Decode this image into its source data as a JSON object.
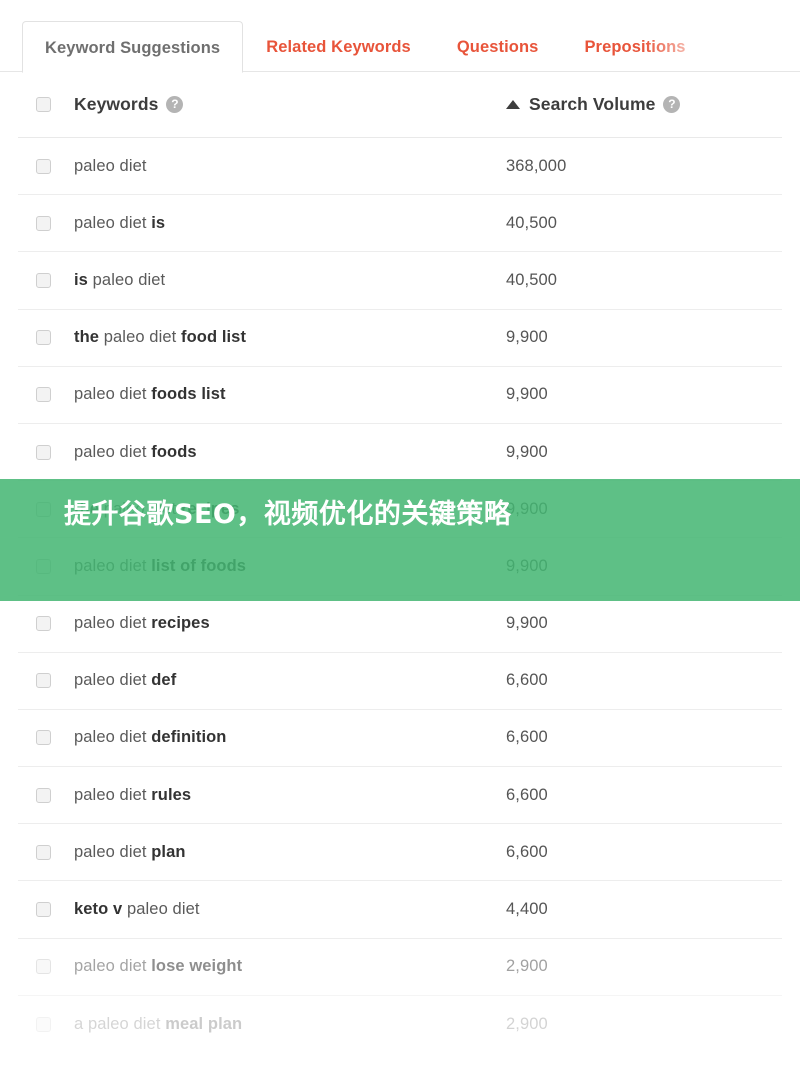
{
  "tabs": [
    {
      "label": "Keyword Suggestions",
      "active": true
    },
    {
      "label": "Related Keywords",
      "active": false
    },
    {
      "label": "Questions",
      "active": false
    },
    {
      "label": "Prepositions",
      "active": false
    }
  ],
  "table": {
    "headers": {
      "keywords": "Keywords",
      "search_volume": "Search Volume",
      "help_glyph": "?",
      "sort_direction": "ascending"
    },
    "rows": [
      {
        "plain": "paleo diet",
        "bold": "",
        "tail": "",
        "volume": "368,000"
      },
      {
        "plain": "paleo diet ",
        "bold": "is",
        "tail": "",
        "volume": "40,500"
      },
      {
        "plain": "",
        "bold": "is",
        "tail": " paleo diet",
        "volume": "40,500"
      },
      {
        "plain": "",
        "bold": "the",
        "tail": "",
        "mid": " paleo diet ",
        "bold2": "food list",
        "volume": "9,900"
      },
      {
        "plain": "paleo diet ",
        "bold": "foods list",
        "tail": "",
        "volume": "9,900"
      },
      {
        "plain": "paleo diet ",
        "bold": "foods",
        "tail": "",
        "volume": "9,900"
      },
      {
        "plain": "",
        "bold": "the",
        "mid": " paleo diet ",
        "bold2": "recipes",
        "tail": "",
        "volume": "9,900"
      },
      {
        "plain": "paleo diet ",
        "bold": "list of foods",
        "tail": "",
        "volume": "9,900"
      },
      {
        "plain": "paleo diet ",
        "bold": "recipes",
        "tail": "",
        "volume": "9,900"
      },
      {
        "plain": "paleo diet ",
        "bold": "def",
        "tail": "",
        "volume": "6,600"
      },
      {
        "plain": "paleo diet ",
        "bold": "definition",
        "tail": "",
        "volume": "6,600"
      },
      {
        "plain": "paleo diet ",
        "bold": "rules",
        "tail": "",
        "volume": "6,600"
      },
      {
        "plain": "paleo diet ",
        "bold": "plan",
        "tail": "",
        "volume": "6,600"
      },
      {
        "plain": "",
        "bold": "keto v",
        "tail": " paleo diet",
        "volume": "4,400"
      },
      {
        "plain": "paleo diet ",
        "bold": "lose weight",
        "tail": "",
        "volume": "2,900"
      },
      {
        "plain": "a paleo diet ",
        "bold": "meal plan",
        "tail": "",
        "volume": "2,900"
      }
    ]
  },
  "banner": {
    "text": "提升谷歌SEO，视频优化的关键策略",
    "background_color": "#44b672",
    "text_color": "#ffffff"
  },
  "colors": {
    "tab_inactive": "#e8543a",
    "tab_active": "#6f6f6f",
    "header_text": "#3d3d3d",
    "row_text": "#5a5a5a",
    "row_bold_text": "#333333"
  }
}
